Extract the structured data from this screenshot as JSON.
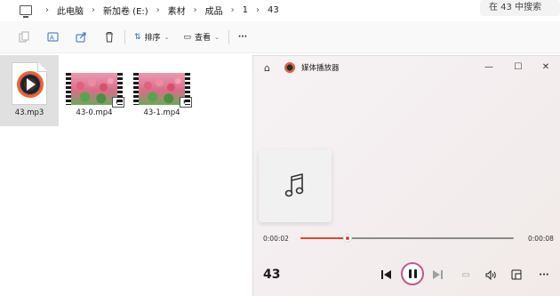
{
  "breadcrumb": [
    "此电脑",
    "新加卷 (E:)",
    "素材",
    "成品",
    "1",
    "43"
  ],
  "search": {
    "placeholder": "在 43 中搜索"
  },
  "toolbar": {
    "sort_label": "排序",
    "view_label": "查看",
    "more_label": "···"
  },
  "files": [
    {
      "name": "43.mp3",
      "type": "audio",
      "selected": true
    },
    {
      "name": "43-0.mp4",
      "type": "video",
      "selected": false
    },
    {
      "name": "43-1.mp4",
      "type": "video",
      "selected": false
    }
  ],
  "player": {
    "title": "媒体播放器",
    "track_title": "43",
    "elapsed": "0:00:02",
    "duration": "0:00:08",
    "progress_fraction": 0.22,
    "state": "playing",
    "accent_color": "#e0482a"
  },
  "window_controls": {
    "minimize": "—",
    "maximize": "☐",
    "close": "✕"
  },
  "icons": {
    "home": "⌂",
    "music_note": "♫",
    "prev": "⏮",
    "next": "⏭",
    "volume": "🔊",
    "miniplayer": "⧉",
    "more": "···",
    "captions": "▭"
  }
}
